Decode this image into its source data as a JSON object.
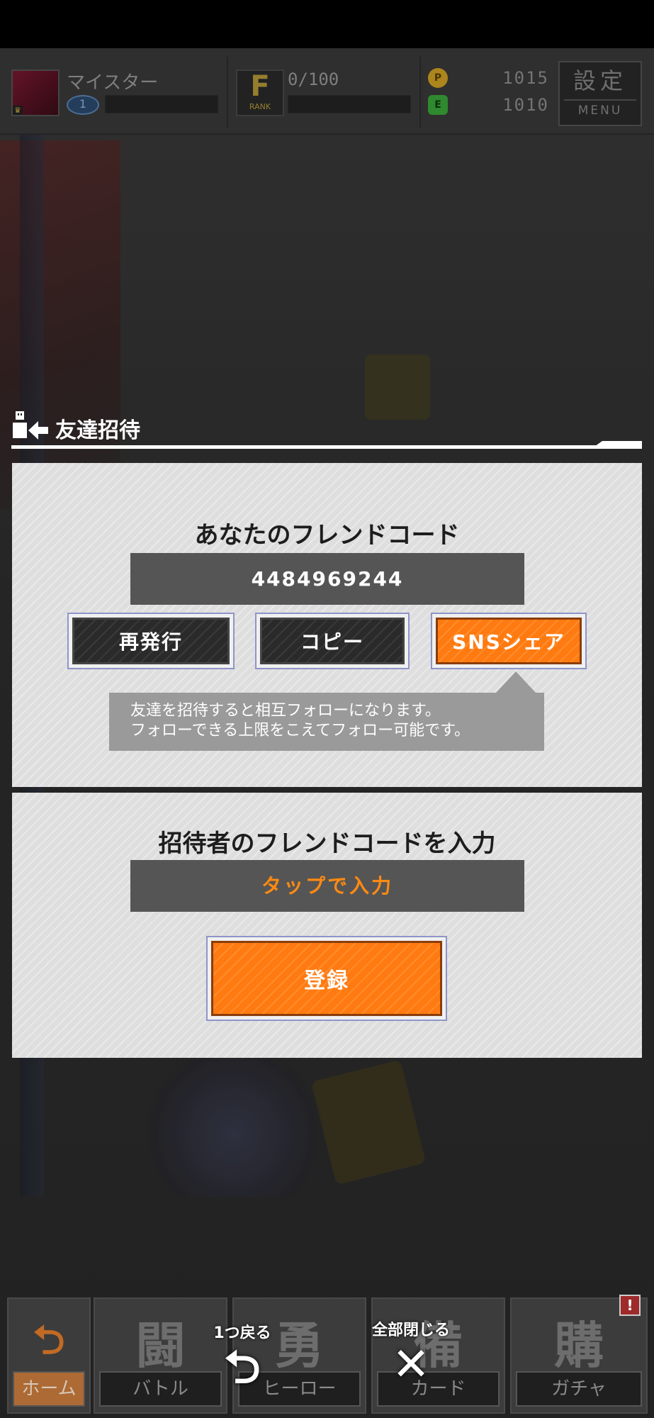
{
  "topbar": {
    "player_name": "マイスター",
    "level_icon": "eye-level-icon",
    "level_value": "1",
    "rank_letter": "F",
    "rank_label": "RANK",
    "rank_progress": "0/100",
    "coin_label": "P",
    "coin_value": "1015",
    "gem_label": "E",
    "gem_value": "1010",
    "menu_kanji": "設定",
    "menu_label": "MENU",
    "coin_color": "#d2a423",
    "gem_color": "#3aa83a"
  },
  "dialog": {
    "title": "友達招待",
    "icon": "friend-invite-icon"
  },
  "my_code": {
    "heading": "あなたのフレンドコード",
    "code": "4484969244",
    "buttons": {
      "reissue": "再発行",
      "copy": "コピー",
      "sns_share": "SNSシェア"
    },
    "tooltip_line1": "友達を招待すると相互フォローになります。",
    "tooltip_line2": "フォローできる上限をこえてフォロー可能です。"
  },
  "invite": {
    "heading": "招待者のフレンドコードを入力",
    "input_placeholder": "タップで入力",
    "register_label": "登録"
  },
  "bottom_nav": {
    "items": [
      {
        "label": "ホーム",
        "kanji": "⮌"
      },
      {
        "label": "バトル",
        "kanji": "闘"
      },
      {
        "label": "ヒーロー",
        "kanji": "勇"
      },
      {
        "label": "カード",
        "kanji": "備"
      },
      {
        "label": "ガチャ",
        "kanji": "購"
      }
    ],
    "alert_badge": "!",
    "back_label": "1つ戻る",
    "close_all_label": "全部閉じる"
  },
  "colors": {
    "accent_orange": "#ff7a10",
    "panel_bg": "#dcdcdc",
    "code_box": "#555555"
  }
}
